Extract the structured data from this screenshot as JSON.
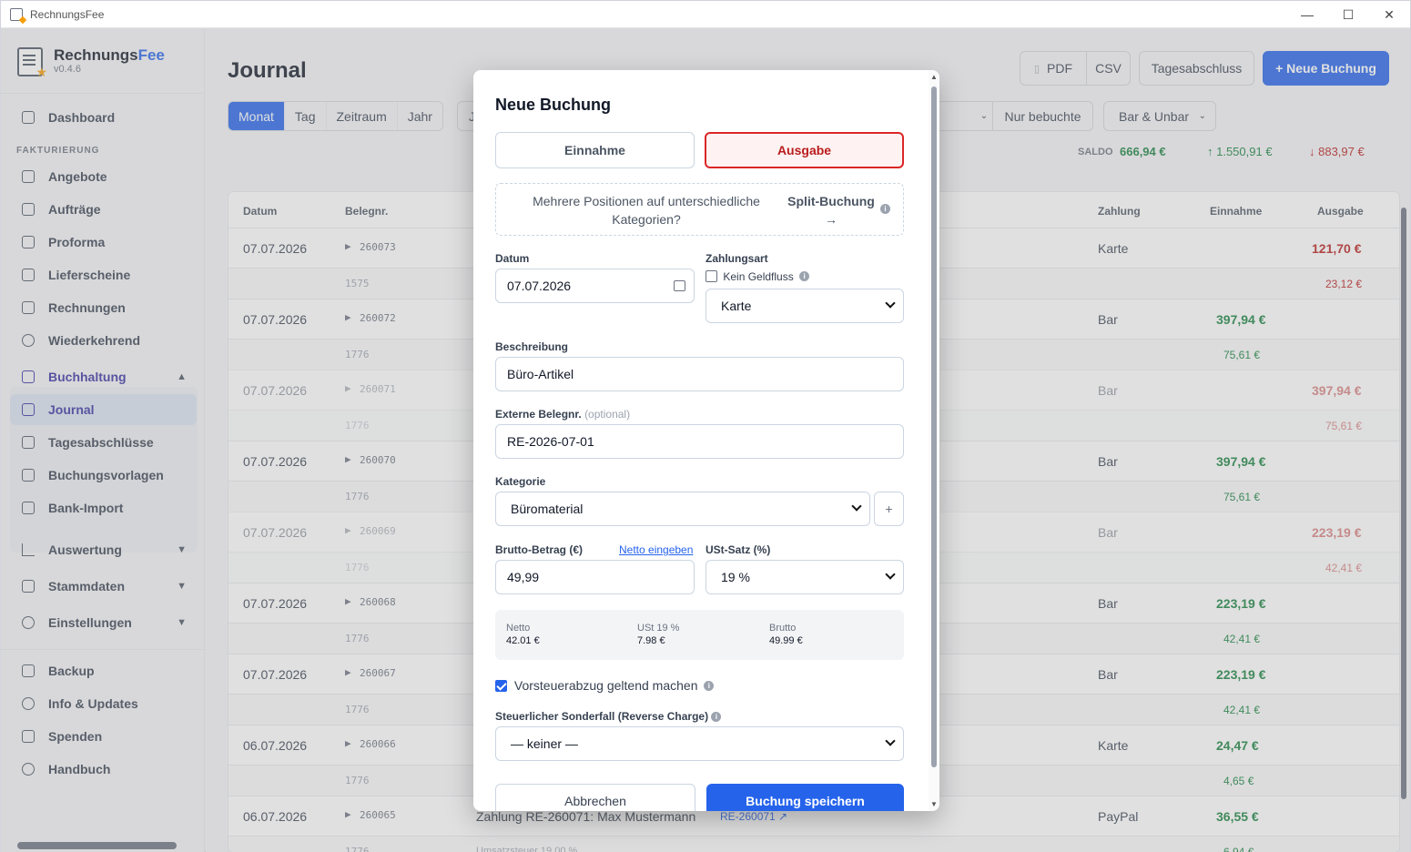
{
  "app": {
    "title": "RechnungsFee"
  },
  "window_controls": {
    "minimize": "—",
    "maximize": "☐",
    "close": "✕"
  },
  "sidebar": {
    "brand_a": "Rechnungs",
    "brand_b": "Fee",
    "version": "v0.4.6",
    "dashboard": "Dashboard",
    "section_label": "FAKTURIERUNG",
    "items": [
      "Angebote",
      "Aufträge",
      "Proforma",
      "Lieferscheine",
      "Rechnungen",
      "Wiederkehrend"
    ],
    "buchhaltung": "Buchhaltung",
    "sub_items": [
      "Journal",
      "Tagesabschlüsse",
      "Buchungsvorlagen",
      "Bank-Import"
    ],
    "groups": [
      "Auswertung",
      "Stammdaten",
      "Einstellungen"
    ],
    "footer": [
      "Backup",
      "Info & Updates",
      "Spenden",
      "Handbuch"
    ]
  },
  "main": {
    "title": "Journal",
    "btn_pdf": "PDF",
    "btn_csv": "CSV",
    "btn_tagesabschluss": "Tagesabschluss",
    "btn_neu": "+ Neue Buchung",
    "periods": [
      "Monat",
      "Tag",
      "Zeitraum",
      "Jahr"
    ],
    "period_partial": "J",
    "filter_nur_bebuchte": "Nur bebuchte",
    "filter_zahlung": "Bar & Unbar",
    "saldo_label": "SALDO",
    "saldo_value": "666,94 €",
    "in_total": "↑ 1.550,91 €",
    "out_total": "↓ 883,97 €",
    "columns": {
      "datum": "Datum",
      "beleg": "Belegnr.",
      "zahlung": "Zahlung",
      "einnahme": "Einnahme",
      "ausgabe": "Ausgabe"
    },
    "rows": [
      {
        "datum": "07.07.2026",
        "beleg": "260073",
        "zahlung": "Karte",
        "einnahme": "",
        "ausgabe": "121,70 €",
        "sub_beleg": "1575",
        "sub_ein": "",
        "sub_aus": "23,12 €"
      },
      {
        "datum": "07.07.2026",
        "beleg": "260072",
        "zahlung": "Bar",
        "einnahme": "397,94 €",
        "ausgabe": "",
        "sub_beleg": "1776",
        "sub_ein": "75,61 €",
        "sub_aus": ""
      },
      {
        "datum": "07.07.2026",
        "beleg": "260071",
        "zahlung": "Bar",
        "einnahme": "",
        "ausgabe": "397,94 €",
        "sub_beleg": "1776",
        "sub_ein": "",
        "sub_aus": "75,61 €"
      },
      {
        "datum": "07.07.2026",
        "beleg": "260070",
        "zahlung": "Bar",
        "einnahme": "397,94 €",
        "ausgabe": "",
        "sub_beleg": "1776",
        "sub_ein": "75,61 €",
        "sub_aus": ""
      },
      {
        "datum": "07.07.2026",
        "beleg": "260069",
        "zahlung": "Bar",
        "einnahme": "",
        "ausgabe": "223,19 €",
        "sub_beleg": "1776",
        "sub_ein": "",
        "sub_aus": "42,41 €"
      },
      {
        "datum": "07.07.2026",
        "beleg": "260068",
        "zahlung": "Bar",
        "einnahme": "223,19 €",
        "ausgabe": "",
        "sub_beleg": "1776",
        "sub_ein": "42,41 €",
        "sub_aus": ""
      },
      {
        "datum": "07.07.2026",
        "beleg": "260067",
        "zahlung": "Bar",
        "einnahme": "223,19 €",
        "ausgabe": "",
        "sub_beleg": "1776",
        "sub_ein": "42,41 €",
        "sub_aus": ""
      },
      {
        "datum": "06.07.2026",
        "beleg": "260066",
        "zahlung": "Karte",
        "einnahme": "24,47 €",
        "ausgabe": "",
        "sub_beleg": "1776",
        "sub_ein": "4,65 €",
        "sub_aus": ""
      },
      {
        "datum": "06.07.2026",
        "beleg": "260065",
        "zahlung": "PayPal",
        "einnahme": "36,55 €",
        "ausgabe": "",
        "sub_beleg": "1776",
        "sub_ein": "6,94 €",
        "sub_aus": ""
      }
    ],
    "last_row_desc": "Zahlung RE-260071: Max Mustermann",
    "last_row_link": "RE-260071 ↗",
    "last_row_sub_desc": "Umsatzsteuer 19,00 %"
  },
  "modal": {
    "title": "Neue Buchung",
    "einnahme": "Einnahme",
    "ausgabe": "Ausgabe",
    "split_text": "Mehrere Positionen auf unterschiedliche Kategorien?",
    "split_link": "Split-Buchung →",
    "datum_label": "Datum",
    "datum_value": "07.07.2026",
    "zahlungsart_label": "Zahlungsart",
    "kein_geldfluss": "Kein Geldfluss",
    "zahlungsart_value": "Karte",
    "beschreibung_label": "Beschreibung",
    "beschreibung_value": "Büro-Artikel",
    "extbeleg_label": "Externe Belegnr.",
    "extbeleg_optional": "(optional)",
    "extbeleg_value": "RE-2026-07-01",
    "kategorie_label": "Kategorie",
    "kategorie_value": "Büromaterial",
    "kategorie_add": "+",
    "brutto_label": "Brutto-Betrag (€)",
    "netto_link": "Netto eingeben",
    "brutto_value": "49,99",
    "ust_label": "USt-Satz (%)",
    "ust_value": "19 %",
    "summary": {
      "netto_k": "Netto",
      "netto_v": "42.01 €",
      "ust_k": "USt 19 %",
      "ust_v": "7.98 €",
      "brutto_k": "Brutto",
      "brutto_v": "49.99 €"
    },
    "vorsteuer_label": "Vorsteuerabzug geltend machen",
    "sonderfall_label": "Steuerlicher Sonderfall (Reverse Charge)",
    "sonderfall_value": "— keiner —",
    "cancel": "Abbrechen",
    "save": "Buchung speichern"
  },
  "colors": {
    "accent": "#2563eb",
    "income": "#15803d",
    "expense": "#b91c1c",
    "brand": "#3730a3"
  }
}
